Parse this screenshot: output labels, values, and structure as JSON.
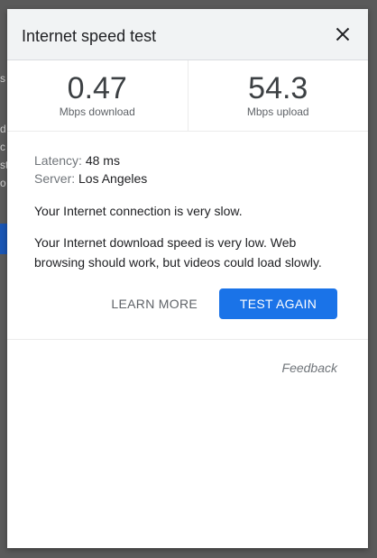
{
  "background": {
    "snippets": [
      "s",
      "d",
      "c",
      "st",
      "o"
    ]
  },
  "dialog": {
    "title": "Internet speed test",
    "close_icon": "close-icon"
  },
  "results": {
    "download": {
      "value": "0.47",
      "unit": "Mbps download"
    },
    "upload": {
      "value": "54.3",
      "unit": "Mbps upload"
    }
  },
  "details": {
    "latency_label": "Latency:",
    "latency_value": "48 ms",
    "server_label": "Server:",
    "server_value": "Los Angeles"
  },
  "messages": {
    "summary": "Your Internet connection is very slow.",
    "detail": "Your Internet download speed is very low. Web browsing should work, but videos could load slowly."
  },
  "actions": {
    "learn_more": "LEARN MORE",
    "test_again": "TEST AGAIN"
  },
  "feedback": "Feedback",
  "colors": {
    "accent": "#1a73e8",
    "header_bg": "#f1f3f4"
  }
}
